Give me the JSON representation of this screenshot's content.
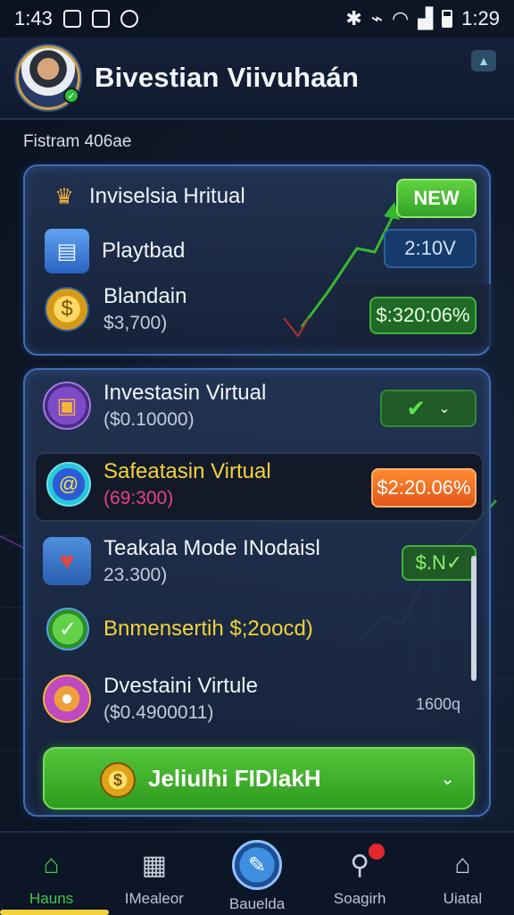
{
  "status_bar": {
    "time_left": "1:43",
    "time_right": "1:29"
  },
  "header": {
    "title": "Bivestian Viivuhaán"
  },
  "subtitle": "Fistram 406ae",
  "card1": {
    "rows": [
      {
        "label": "Inviselsia Hritual",
        "badge": "NEW"
      },
      {
        "label": "Playtbad",
        "badge": "2:10V"
      },
      {
        "label": "Blandain",
        "sub": "$3,700)",
        "badge": "$:320:06%"
      }
    ]
  },
  "card2": {
    "rows": [
      {
        "label": "Investasin Virtual",
        "sub": "($0.10000)"
      },
      {
        "label": "Safeatasin Virtual",
        "sub": "(69:300)",
        "badge": "$2:20.06%"
      },
      {
        "label": "Teakala Mode INodaisl",
        "sub": "23.300)",
        "badge": "$.N✓"
      },
      {
        "label": "Bnmensertih $;2oocd)"
      },
      {
        "label": "Dvestaini Virtule",
        "sub": "($0.4900011)",
        "side_note": "1600q"
      }
    ],
    "primary_button": "Jeliulhi FIDlakH"
  },
  "nav": {
    "items": [
      {
        "label": "Hauns",
        "icon": "home-icon"
      },
      {
        "label": "IMealeor",
        "icon": "news-icon"
      },
      {
        "label": "Bauelda",
        "icon": "wallet-icon"
      },
      {
        "label": "Soagirh",
        "icon": "search-icon"
      },
      {
        "label": "Uiatal",
        "icon": "bank-icon"
      }
    ]
  },
  "colors": {
    "accent_green": "#43c84a",
    "accent_blue": "#3e6db2",
    "warn_orange": "#f07a28",
    "alert_red": "#e0282d"
  }
}
